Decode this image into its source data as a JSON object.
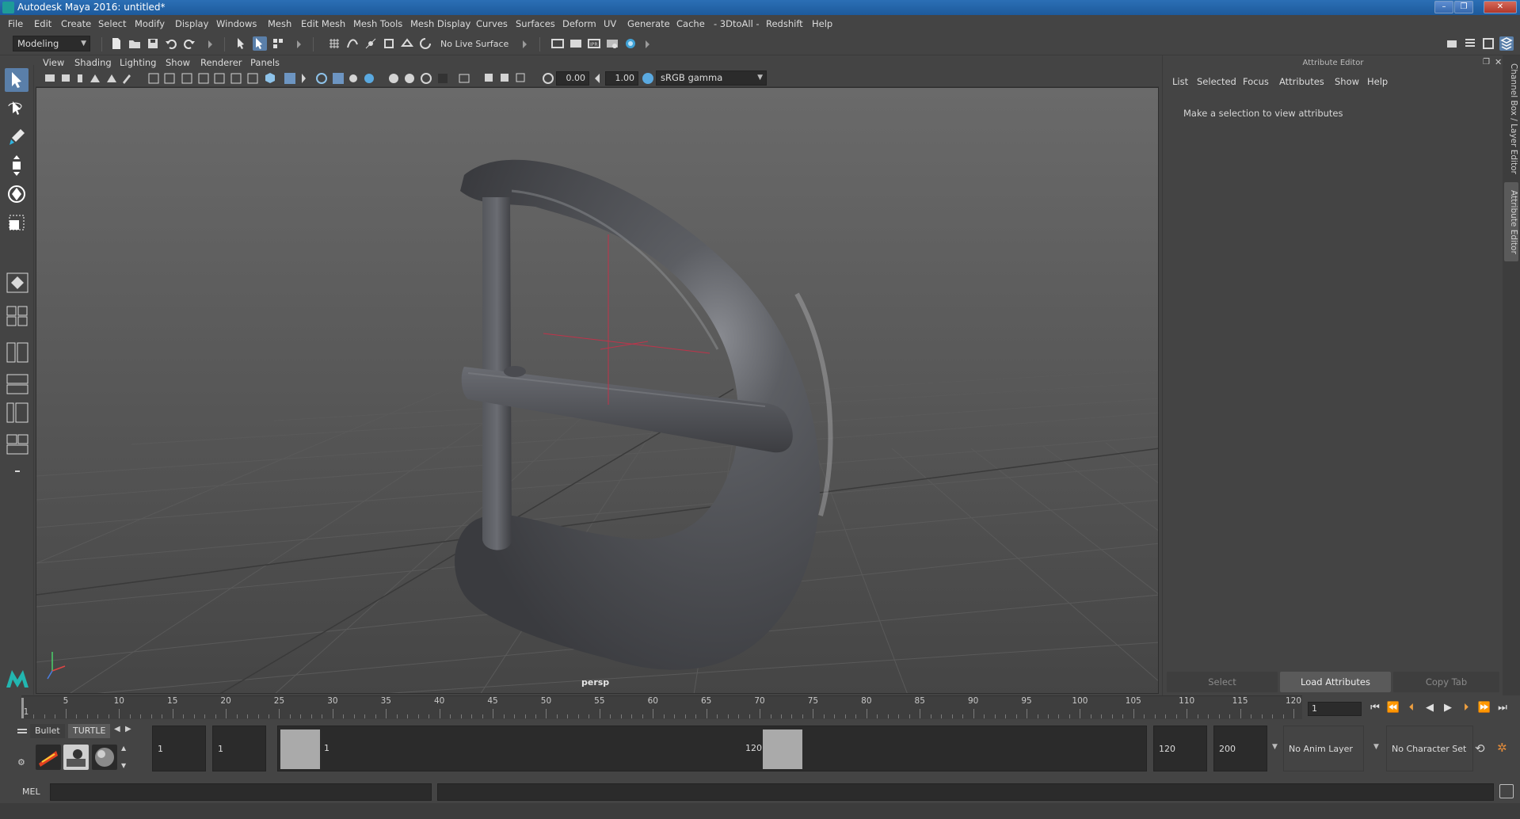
{
  "window": {
    "title": "Autodesk Maya 2016: untitled*",
    "controls": [
      "–",
      "❐",
      "✕"
    ]
  },
  "menubar": [
    "File",
    "Edit",
    "Create",
    "Select",
    "Modify",
    "Display",
    "Windows",
    "Mesh",
    "Edit Mesh",
    "Mesh Tools",
    "Mesh Display",
    "Curves",
    "Surfaces",
    "Deform",
    "UV",
    "Generate",
    "Cache",
    "- 3DtoAll -",
    "Redshift",
    "Help"
  ],
  "statusline": {
    "mode": "Modeling",
    "live_surface": "No Live Surface"
  },
  "viewport_menu": [
    "View",
    "Shading",
    "Lighting",
    "Show",
    "Renderer",
    "Panels"
  ],
  "viewport_toolbar": {
    "exposure": "0.00",
    "gamma": "1.00",
    "color_space": "sRGB gamma"
  },
  "viewport": {
    "camera_label": "persp"
  },
  "attribute_editor": {
    "title": "Attribute Editor",
    "menu": [
      "List",
      "Selected",
      "Focus",
      "Attributes",
      "Show",
      "Help"
    ],
    "hint": "Make a selection to view attributes",
    "buttons": {
      "select": "Select",
      "load": "Load Attributes",
      "copy": "Copy Tab"
    }
  },
  "side_tabs": {
    "channel_box": "Channel Box / Layer Editor",
    "attribute_editor": "Attribute Editor"
  },
  "timeslider": {
    "ticks": [
      1,
      5,
      10,
      15,
      20,
      25,
      30,
      35,
      40,
      45,
      50,
      55,
      60,
      65,
      70,
      75,
      80,
      85,
      90,
      95,
      100,
      105,
      110,
      115,
      120
    ],
    "current_frame": "1",
    "current_frame_field": "1"
  },
  "shelf": {
    "tabs": [
      "Bullet",
      "TURTLE"
    ]
  },
  "range": {
    "start_field": "1",
    "playback_start": "1",
    "range_start_label": "1",
    "range_end_label": "120",
    "playback_end": "120",
    "end_field": "200",
    "anim_layer": "No Anim Layer",
    "character_set": "No Character Set"
  },
  "cmdline": {
    "language": "MEL"
  }
}
